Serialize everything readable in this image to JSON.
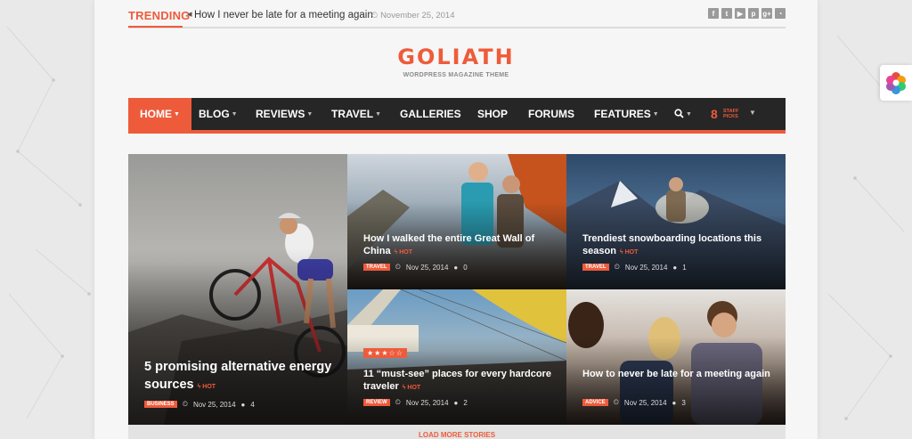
{
  "trending": {
    "label": "TRENDING",
    "arrow": "◂",
    "headline": "How I never be late for a meeting again",
    "date": "November 25, 2014"
  },
  "social_icons": [
    {
      "name": "facebook-icon",
      "glyph": "f"
    },
    {
      "name": "twitter-icon",
      "glyph": "t"
    },
    {
      "name": "youtube-icon",
      "glyph": "▶"
    },
    {
      "name": "pinterest-icon",
      "glyph": "p"
    },
    {
      "name": "google-plus-icon",
      "glyph": "g+"
    },
    {
      "name": "rss-icon",
      "glyph": "◔"
    }
  ],
  "logo": {
    "text": "GOLIATH",
    "tagline": "WORDPRESS MAGAZINE THEME"
  },
  "nav": {
    "home": "HOME",
    "blog": "BLOG",
    "reviews": "REVIEWS",
    "travel": "TRAVEL",
    "galleries": "GALLERIES",
    "shop": "SHOP",
    "forums": "FORUMS",
    "features": "FEATURES",
    "search": "Q",
    "staff_count": "8",
    "staff_label": "STAFF PICKS"
  },
  "cards": {
    "c1": {
      "title": "5 promising alternative energy sources",
      "hot": "HOT",
      "category": "BUSINESS",
      "date": "Nov 25, 2014",
      "comments": "4"
    },
    "c2": {
      "title": "How I walked the entire Great Wall of China",
      "hot": "HOT",
      "category": "TRAVEL",
      "date": "Nov 25, 2014",
      "comments": "0"
    },
    "c3": {
      "title": "Trendiest snowboarding locations this season",
      "hot": "HOT",
      "category": "TRAVEL",
      "date": "Nov 25, 2014",
      "comments": "1"
    },
    "c4": {
      "title": "11 “must-see” places for every hardcore traveler",
      "hot": "HOT",
      "category": "REVIEW",
      "date": "Nov 25, 2014",
      "comments": "2",
      "rating": 3,
      "rating_max": 5,
      "stars": "★★★☆☆"
    },
    "c5": {
      "title": "How to never be late for a meeting again",
      "category": "ADVICE",
      "date": "Nov 25, 2014",
      "comments": "3"
    }
  },
  "load_more": "LOAD MORE STORIES",
  "colors": {
    "accent": "#ee5b3b",
    "nav_bg": "#262626"
  }
}
